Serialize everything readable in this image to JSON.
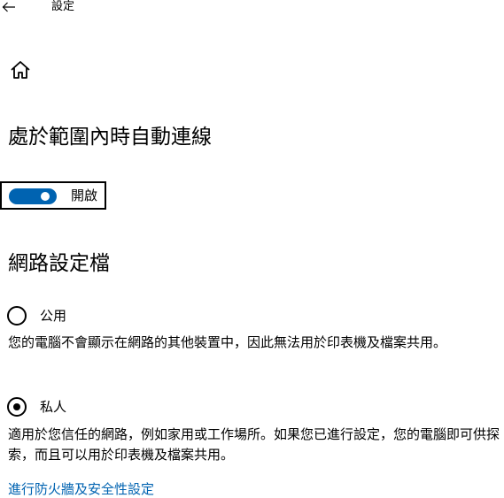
{
  "window": {
    "back_icon": "arrow-left-icon",
    "title": "設定"
  },
  "nav": {
    "home_icon": "home-icon"
  },
  "auto_connect": {
    "heading": "處於範圍內時自動連線",
    "toggle": {
      "state": true,
      "label": "開啟",
      "accent_color": "#0063b1"
    }
  },
  "network_profile": {
    "heading": "網路設定檔",
    "options": [
      {
        "label": "公用",
        "selected": false,
        "description": "您的電腦不會顯示在網路的其他裝置中，因此無法用於印表機及檔案共用。"
      },
      {
        "label": "私人",
        "selected": true,
        "description": "適用於您信任的網路，例如家用或工作場所。如果您已進行設定，您的電腦即可供探索，而且可以用於印表機及檔案共用。"
      }
    ]
  },
  "links": {
    "firewall": "進行防火牆及安全性設定",
    "link_color": "#0063b1"
  }
}
